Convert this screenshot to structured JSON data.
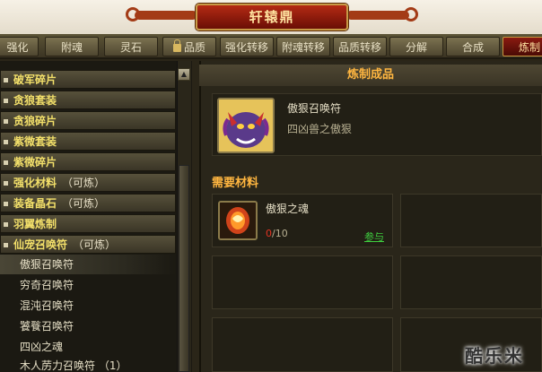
{
  "window": {
    "title": "轩辕鼎"
  },
  "tabs": [
    {
      "label": "强化"
    },
    {
      "label": "附魂"
    },
    {
      "label": "灵石"
    },
    {
      "label": "品质",
      "locked": true
    },
    {
      "label": "强化转移"
    },
    {
      "label": "附魂转移"
    },
    {
      "label": "品质转移"
    },
    {
      "label": "分解"
    },
    {
      "label": "合成"
    },
    {
      "label": "炼制",
      "active": true
    }
  ],
  "sidebar": {
    "categories": [
      {
        "label": "破军碎片"
      },
      {
        "label": "贪狼套装"
      },
      {
        "label": "贪狼碎片"
      },
      {
        "label": "紫微套装"
      },
      {
        "label": "紫微碎片"
      },
      {
        "label": "强化材料",
        "suffix": "（可炼）"
      },
      {
        "label": "装备晶石",
        "suffix": "（可炼）"
      },
      {
        "label": "羽翼炼制"
      },
      {
        "label": "仙宠召唤符",
        "suffix": "（可炼）"
      }
    ],
    "items": [
      {
        "label": "傲狠召唤符",
        "selected": true
      },
      {
        "label": "穷奇召唤符"
      },
      {
        "label": "混沌召唤符"
      },
      {
        "label": "饕餮召唤符"
      },
      {
        "label": "四凶之魂"
      },
      {
        "label": "木人苈力召唤符 （1）"
      }
    ]
  },
  "product": {
    "section_title": "炼制成品",
    "name": "傲狠召唤符",
    "subtitle": "四凶兽之傲狠",
    "icon": "beast-summon-icon"
  },
  "materials": {
    "section_title": "需要材料",
    "items": [
      {
        "name": "傲狠之魂",
        "have": "0",
        "need": "/10",
        "link": "参与",
        "icon": "soul-orb-icon"
      }
    ]
  },
  "watermark": "酷乐米",
  "colors": {
    "accent_gold": "#ffb640",
    "category_yellow": "#f3e06a",
    "link_green": "#3fcf3f",
    "count_red": "#e53322"
  }
}
